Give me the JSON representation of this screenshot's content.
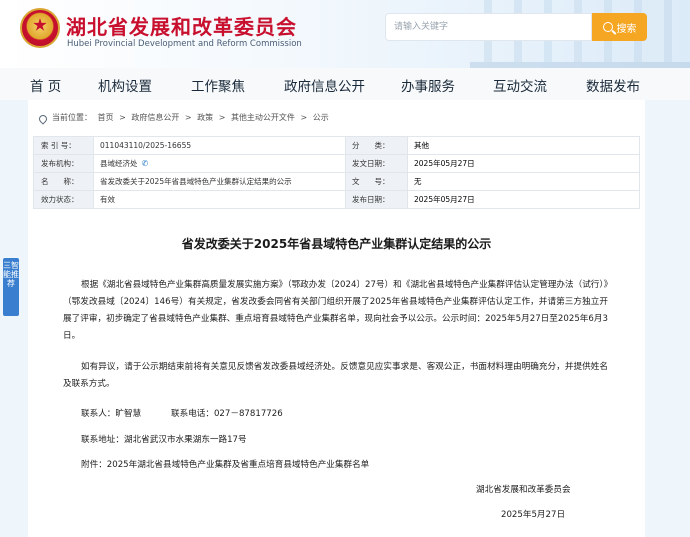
{
  "header": {
    "site_title": "湖北省发展和改革委员会",
    "site_subtitle": "Hubei Provincial Development and Reform Commission",
    "search_placeholder": "请输入关键字",
    "search_button": "搜索"
  },
  "nav": {
    "items": [
      "首 页",
      "机构设置",
      "工作聚焦",
      "政府信息公开",
      "办事服务",
      "互动交流",
      "数据发布"
    ]
  },
  "side_tab": {
    "label": "三智能推荐"
  },
  "breadcrumb": {
    "prefix": "当前位置：",
    "items": [
      "首页",
      "政府信息公开",
      "政策",
      "其他主动公开文件",
      "公示"
    ],
    "separator": ">"
  },
  "meta": {
    "index_label": "索 引 号：",
    "index_value": "011043110/2025-16655",
    "category_label": "分　　类：",
    "category_value": "其他",
    "issuer_label": "发布机构：",
    "issuer_value": "县域经济处",
    "issue_date_label": "发文日期：",
    "issue_date_value": "2025年05月27日",
    "name_label": "名　　称：",
    "name_value": "省发改委关于2025年省县域特色产业集群认定结果的公示",
    "doc_no_label": "文　　号：",
    "doc_no_value": "无",
    "validity_label": "效力状态：",
    "validity_value": "有效",
    "publish_date_label": "发布日期：",
    "publish_date_value": "2025年05月27日"
  },
  "document": {
    "title": "省发改委关于2025年省县域特色产业集群认定结果的公示",
    "paragraph1": "根据《湖北省县域特色产业集群高质量发展实施方案》（鄂政办发〔2024〕27号）和《湖北省县域特色产业集群评估认定管理办法（试行）》（鄂发改县域〔2024〕146号）有关规定，省发改委会同省有关部门组织开展了2025年省县域特色产业集群评估认定工作，并请第三方独立开展了评审，初步确定了省县域特色产业集群、重点培育县域特色产业集群名单，现向社会予以公示。公示时间：2025年5月27日至2025年6月3日。",
    "paragraph2": "如有异议，请于公示期结束前将有关意见反馈省发改委县域经济处。反馈意见应实事求是、客观公正，书面材料理由明确充分，并提供姓名及联系方式。",
    "contact_person": "联系人：旷智慧",
    "contact_phone": "联系电话：027－87817726",
    "address": "联系地址：湖北省武汉市水果湖东一路17号",
    "attachment": "附件：2025年湖北省县域特色产业集群及省重点培育县域特色产业集群名单",
    "signature": "湖北省发展和改革委员会",
    "date": "2025年5月27日"
  }
}
